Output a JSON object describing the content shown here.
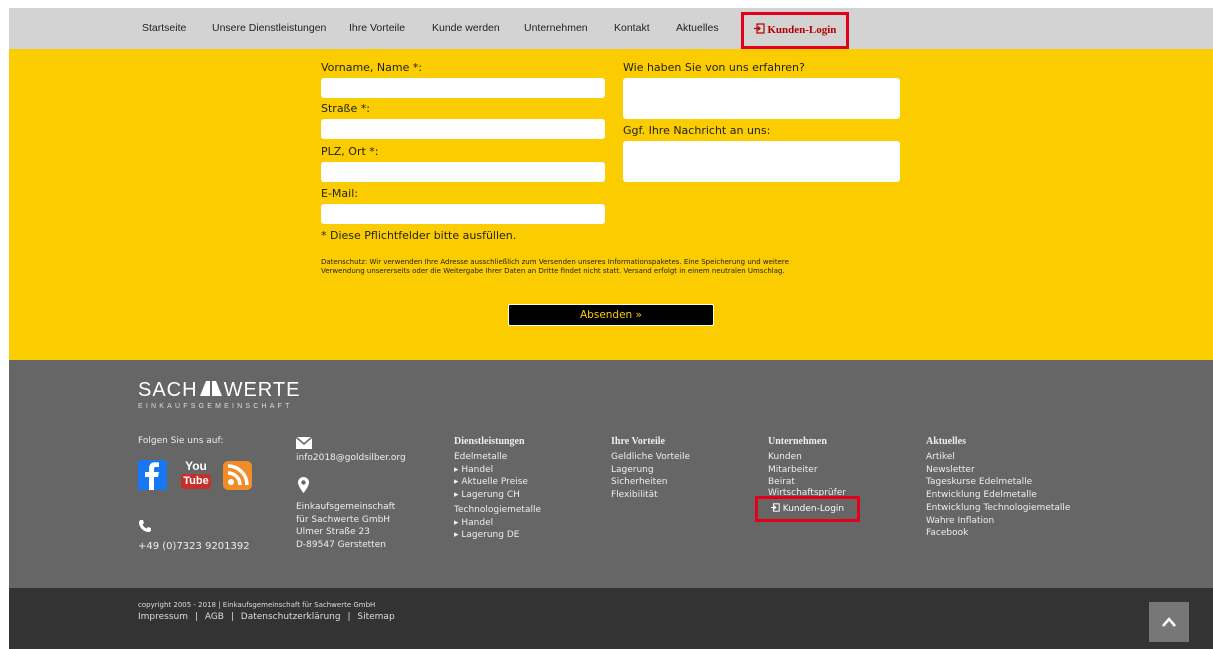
{
  "nav": {
    "items": [
      "Startseite",
      "Unsere Dienstleistungen",
      "Ihre Vorteile",
      "Kunde werden",
      "Unternehmen",
      "Kontakt",
      "Aktuelles"
    ],
    "login_label": "Kunden-Login"
  },
  "form": {
    "name_label": "Vorname, Name *:",
    "street_label": "Straße *:",
    "city_label": "PLZ, Ort *:",
    "email_label": "E-Mail:",
    "source_label": "Wie haben Sie von uns erfahren?",
    "message_label": "Ggf. Ihre Nachricht an uns:",
    "required_note": "* Diese Pflichtfelder bitte ausfüllen.",
    "privacy_line1": "Datenschutz: Wir verwenden Ihre Adresse ausschließlich zum Versenden unseres Informationspaketes. Eine Speicherung und weitere",
    "privacy_line2": "Verwendung unsererseits oder die Weitergabe Ihrer Daten an Dritte findet nicht statt. Versand erfolgt in einem neutralen Umschlag.",
    "submit_label": "Absenden »"
  },
  "footer": {
    "logo_left": "SACH",
    "logo_right": "WERTE",
    "logo_sub": "EINKAUFSGEMEINSCHAFT",
    "follow_label": "Folgen Sie uns auf:",
    "email": "info2018@goldsilber.org",
    "address": [
      "Einkaufsgemeinschaft",
      "für Sachwerte GmbH",
      "Ulmer Straße 23",
      "D-89547 Gerstetten"
    ],
    "phone": "+49 (0)7323 9201392",
    "col_services": {
      "title": "Dienstleistungen",
      "items": [
        "Edelmetalle",
        "▸ Handel",
        "▸ Aktuelle Preise",
        "▸ Lagerung CH",
        "Technologiemetalle",
        "▸ Handel",
        "▸ Lagerung DE"
      ]
    },
    "col_benefits": {
      "title": "Ihre Vorteile",
      "items": [
        "Geldliche Vorteile",
        "Lagerung",
        "Sicherheiten",
        "Flexibilität"
      ]
    },
    "col_company": {
      "title": "Unternehmen",
      "items": [
        "Kunden",
        "Mitarbeiter",
        "Beirat"
      ],
      "overlap_item": "Wirtschaftsprüfer",
      "login_label": "Kunden-Login"
    },
    "col_news": {
      "title": "Aktuelles",
      "items": [
        "Artikel",
        "Newsletter",
        "Tageskurse Edelmetalle",
        "Entwicklung Edelmetalle",
        "Entwicklung Technologiemetalle",
        "Wahre Inflation",
        "Facebook"
      ]
    },
    "social": {
      "youtube_top": "You",
      "youtube_bottom": "Tube"
    }
  },
  "bottom": {
    "copyright": "copyright 2005 - 2018 | Einkaufsgemeinschaft für Sachwerte GmbH",
    "links": [
      "Impressum",
      "AGB",
      "Datenschutzerklärung",
      "Sitemap"
    ],
    "separator": "|"
  },
  "colors": {
    "accent_yellow": "#fbcd00",
    "highlight_red": "#e3001b",
    "footer_gray": "#666666",
    "bottom_dark": "#333333"
  }
}
